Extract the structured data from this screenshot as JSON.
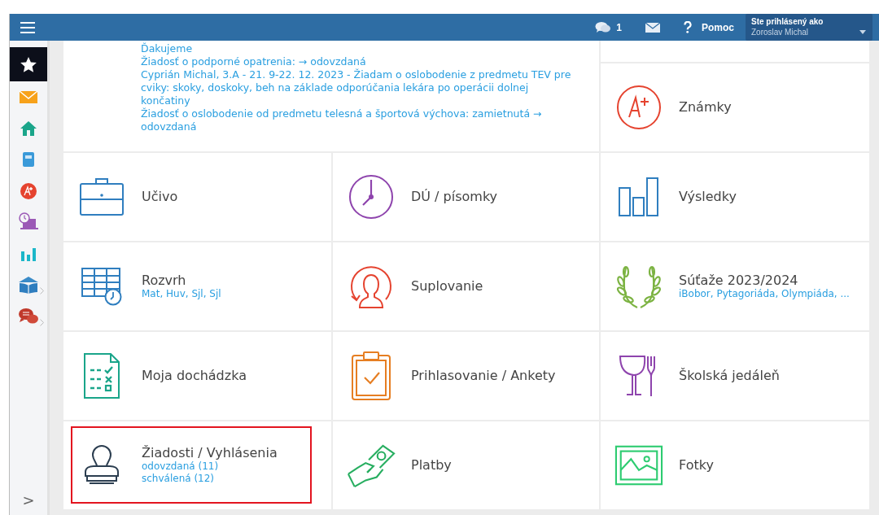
{
  "topbar": {
    "messages_count": "1",
    "help": "Pomoc",
    "user_label": "Ste prihlásený ako",
    "user_name": "Zoroslav Michal"
  },
  "sidebar": {
    "items": [
      {
        "selected": true,
        "has_submenu": false
      },
      {
        "selected": false,
        "has_submenu": false
      },
      {
        "selected": false,
        "has_submenu": false
      },
      {
        "selected": false,
        "has_submenu": false
      },
      {
        "selected": false,
        "has_submenu": false
      },
      {
        "selected": false,
        "has_submenu": false
      },
      {
        "selected": false,
        "has_submenu": false
      },
      {
        "selected": false,
        "has_submenu": true
      },
      {
        "selected": false,
        "has_submenu": true
      }
    ],
    "toggle": ">"
  },
  "notices": [
    "Ďakujeme",
    "Žiadosť o podporné opatrenia: → odovzdaná",
    "Cyprián Michal, 3.A - 21. 9-22. 12. 2023 - Žiadam o oslobodenie z predmetu TEV pre cviky: skoky, doskoky, beh na základe odporúčania lekára po operácii dolnej končatiny",
    "Žiadosť o oslobodenie od predmetu telesná a športová výchova: zamietnutá → odovzdaná"
  ],
  "tiles": [
    {
      "title": "Známky",
      "highlighted": false
    },
    {
      "title": "Učivo",
      "highlighted": false
    },
    {
      "title": "DÚ / písomky",
      "highlighted": false
    },
    {
      "title": "Výsledky",
      "highlighted": false
    },
    {
      "title": "Rozvrh",
      "details": [
        "Mat, Huv, Sjl, Sjl"
      ],
      "highlighted": false
    },
    {
      "title": "Suplovanie",
      "highlighted": false
    },
    {
      "title": "Súťaže 2023/2024",
      "details": [
        "iBobor, Pytagoriáda, Olympiáda, ..."
      ],
      "highlighted": false
    },
    {
      "title": "Moja dochádzka",
      "highlighted": false
    },
    {
      "title": "Prihlasovanie / Ankety",
      "highlighted": false
    },
    {
      "title": "Školská jedáleň",
      "highlighted": false
    },
    {
      "title": "Žiadosti / Vyhlásenia",
      "details": [
        "odovzdaná (11)",
        "schválená (12)"
      ],
      "highlighted": true
    },
    {
      "title": "Platby",
      "highlighted": false
    },
    {
      "title": "Fotky",
      "highlighted": false
    }
  ]
}
